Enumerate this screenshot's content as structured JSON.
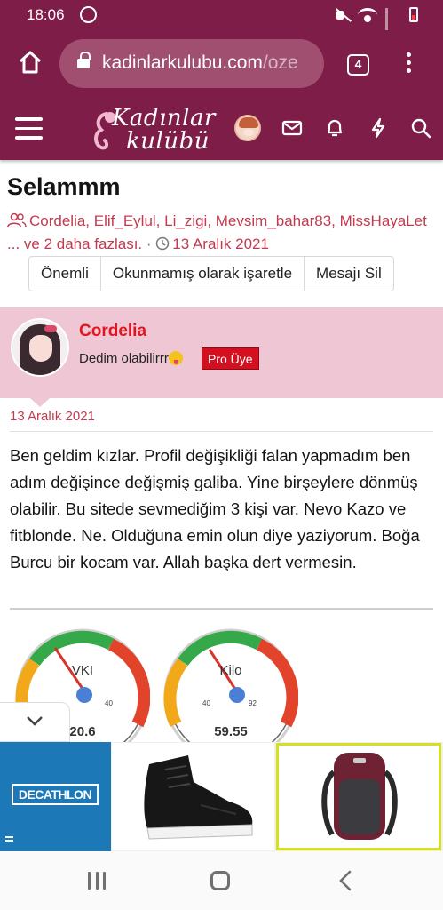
{
  "status_bar": {
    "time": "18:06",
    "icons": [
      "whatsapp-icon",
      "mute-icon",
      "wifi-icon",
      "signal-icon",
      "battery-icon"
    ]
  },
  "browser": {
    "url_host": "kadinlarkulubu.com",
    "url_path": "/oze",
    "tab_count": "4"
  },
  "site_header": {
    "logo_line1": "Kadınlar",
    "logo_line2": "kulübü",
    "icons": [
      "menu-icon",
      "avatar",
      "mail-icon",
      "bell-icon",
      "lightning-icon",
      "search-icon"
    ]
  },
  "thread": {
    "title": "Selammm",
    "participants": "Cordelia, Elif_Eylul, Li_zigi, Mevsim_bahar83, MissHayaLet ... ve 2 daha fazlası.",
    "separator": " · ",
    "date": "13 Aralık 2021",
    "actions": [
      "Önemli",
      "Okunmamış olarak işaretle",
      "Mesajı Sil"
    ]
  },
  "post": {
    "username": "Cordelia",
    "user_title": "Dedim olabilirrr",
    "badge": "Pro Üye",
    "date": "13 Aralık 2021",
    "body": "Ben geldim kızlar. Profil değişikliği falan yapmadım ben adım değişince değişmiş galiba. Yine birşeylere dönmüş olabilir. Bu sitede sevmediğim 3 kişi var. Nevo Kazo ve fitblonde. Ne. Olduğuna emin olun diye yaziyorum. Boğa Burcu bir kocam var. Allah başka dert vermesin."
  },
  "gauges": [
    {
      "label": "VKI",
      "value": "20.6",
      "min": "",
      "max": "40"
    },
    {
      "label": "Kilo",
      "value": "59.55",
      "min": "40",
      "max": "92"
    }
  ],
  "ad": {
    "brand": "DECATHLON"
  },
  "colors": {
    "header": "#7e1e48",
    "accent": "#c33a4f",
    "user_bg": "#efc6d3",
    "badge": "#d40f1f",
    "username": "#e2141f"
  }
}
